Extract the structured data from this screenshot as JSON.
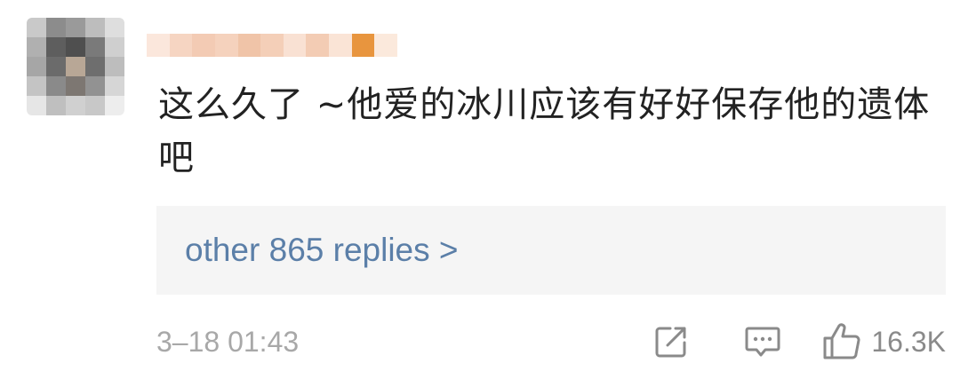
{
  "comment": {
    "text": "这么久了 ~他爱的冰川应该有好好保存他的遗体吧"
  },
  "replies": {
    "label": "other 865 replies >"
  },
  "footer": {
    "timestamp": "3–18 01:43",
    "like_count": "16.3K"
  },
  "icons": {
    "share": "share-icon",
    "comment": "comment-icon",
    "like": "thumbs-up-icon"
  },
  "colors": {
    "link": "#5b7fa8",
    "muted": "#a8a8a8",
    "reply_background": "#f5f5f5"
  }
}
